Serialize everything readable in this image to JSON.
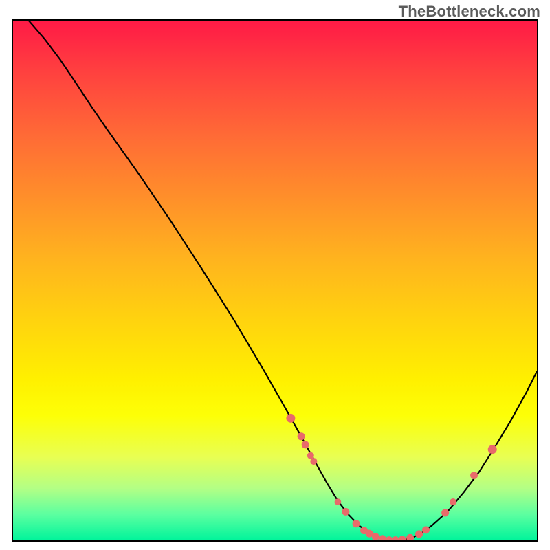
{
  "branding": {
    "watermark": "TheBottleneck.com"
  },
  "chart_data": {
    "type": "line",
    "title": "",
    "xlabel": "",
    "ylabel": "",
    "xlim": [
      0,
      100
    ],
    "ylim": [
      0,
      100
    ],
    "grid": false,
    "legend": false,
    "background_gradient": {
      "top": "#ff1a46",
      "mid": "#fff000",
      "bottom": "#00f49b"
    },
    "series": [
      {
        "name": "bottleneck-curve",
        "color": "#000000",
        "x": [
          0,
          3,
          6,
          9,
          12,
          15,
          18,
          24,
          30,
          36,
          42,
          48,
          52,
          55,
          58,
          60,
          62,
          64,
          66,
          68,
          70,
          72,
          74,
          76,
          78,
          80,
          83,
          86,
          89,
          92,
          95,
          98,
          100
        ],
        "y": [
          103,
          100,
          96.5,
          92.5,
          88,
          83.4,
          79,
          70.5,
          61.6,
          52.3,
          42.7,
          32.5,
          25.4,
          20,
          14.5,
          10.9,
          7.6,
          5,
          2.9,
          1.4,
          0.45,
          0.05,
          0.05,
          0.45,
          1.4,
          2.9,
          5.6,
          9.2,
          13.2,
          18,
          23,
          28.5,
          32.5
        ]
      }
    ],
    "markers": {
      "name": "highlighted-points",
      "color": "#e86a6a",
      "points": [
        {
          "x": 53.0,
          "y": 23.5,
          "r": 6.5
        },
        {
          "x": 55.0,
          "y": 20.0,
          "r": 5.5
        },
        {
          "x": 55.8,
          "y": 18.4,
          "r": 5.5
        },
        {
          "x": 56.8,
          "y": 16.3,
          "r": 5.0
        },
        {
          "x": 57.4,
          "y": 15.2,
          "r": 5.0
        },
        {
          "x": 62.0,
          "y": 7.4,
          "r": 4.8
        },
        {
          "x": 63.5,
          "y": 5.5,
          "r": 5.5
        },
        {
          "x": 65.5,
          "y": 3.2,
          "r": 5.5
        },
        {
          "x": 67.0,
          "y": 1.9,
          "r": 5.5
        },
        {
          "x": 68.0,
          "y": 1.3,
          "r": 5.5
        },
        {
          "x": 69.2,
          "y": 0.7,
          "r": 5.5
        },
        {
          "x": 70.5,
          "y": 0.3,
          "r": 5.5
        },
        {
          "x": 71.8,
          "y": 0.05,
          "r": 5.5
        },
        {
          "x": 73.0,
          "y": 0.05,
          "r": 5.5
        },
        {
          "x": 74.3,
          "y": 0.15,
          "r": 5.5
        },
        {
          "x": 75.8,
          "y": 0.5,
          "r": 5.5
        },
        {
          "x": 77.5,
          "y": 1.2,
          "r": 5.5
        },
        {
          "x": 78.8,
          "y": 2.0,
          "r": 5.5
        },
        {
          "x": 82.5,
          "y": 5.3,
          "r": 5.5
        },
        {
          "x": 84.0,
          "y": 7.4,
          "r": 5.0
        },
        {
          "x": 88.0,
          "y": 12.5,
          "r": 5.5
        },
        {
          "x": 91.5,
          "y": 17.5,
          "r": 6.5
        }
      ]
    }
  }
}
